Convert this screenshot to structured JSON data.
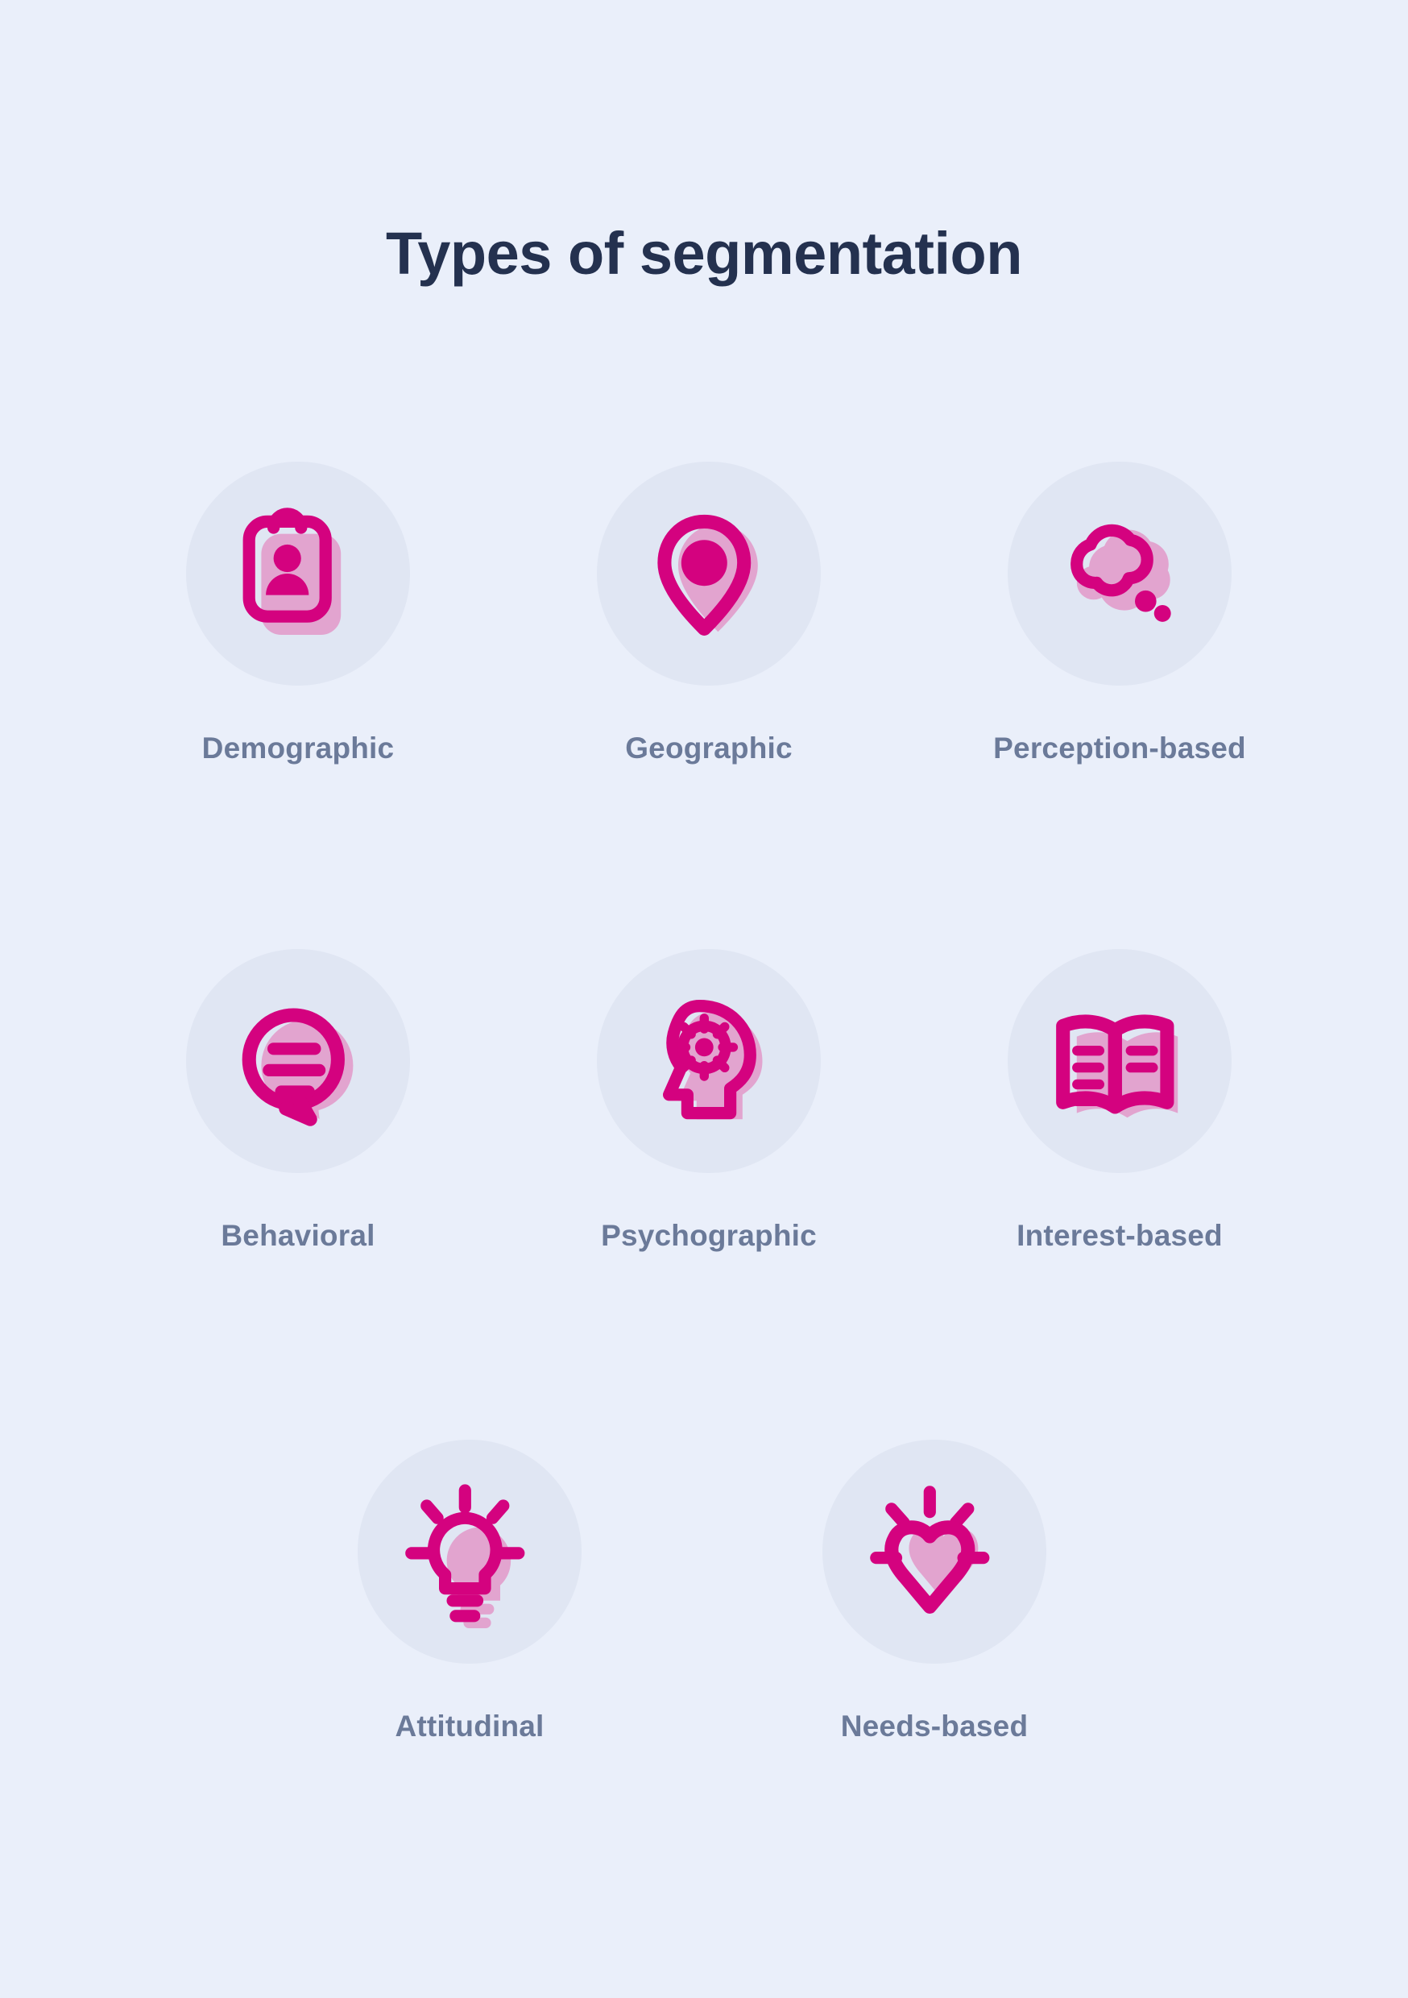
{
  "page": {
    "title": "Types of segmentation",
    "background_color": "#eaeffa",
    "circle_color": "#e0e6f3",
    "title_color": "#24314f",
    "label_color": "#6b7a99",
    "accent_color": "#d4027f",
    "accent_light_color": "#e2a4cf"
  },
  "segments": [
    {
      "label": "Demographic",
      "icon": "clipboard-person-icon"
    },
    {
      "label": "Geographic",
      "icon": "map-pin-icon"
    },
    {
      "label": "Perception-based",
      "icon": "thought-cloud-icon"
    },
    {
      "label": "Behavioral",
      "icon": "speech-bubble-lines-icon"
    },
    {
      "label": "Psychographic",
      "icon": "head-gear-icon"
    },
    {
      "label": "Interest-based",
      "icon": "open-book-icon"
    },
    {
      "label": "Attitudinal",
      "icon": "lightbulb-icon"
    },
    {
      "label": "Needs-based",
      "icon": "radiating-heart-icon"
    }
  ]
}
